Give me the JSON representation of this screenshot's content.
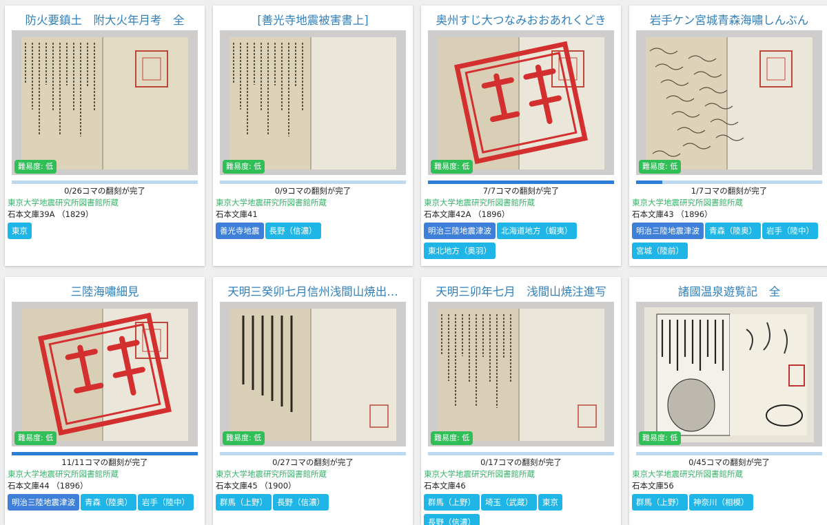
{
  "colors": {
    "title": "#3080bb",
    "badge": "#2fbf56",
    "progress_fill": "#2b7ed6",
    "progress_track": "#bcd9ef",
    "tag": "#1fb5e6",
    "tag_dark": "#3d7fd9",
    "holder": "#3ab36a"
  },
  "cards": [
    {
      "title": "防火要鎮土　附大火年月考　全",
      "badge": "難易度: 低",
      "progress_text": "0/26コマの翻刻が完了",
      "progress": 0.0,
      "holder": "東京大学地震研究所図書館所蔵",
      "call_no": "石本文庫39A （1829）",
      "tags": [
        {
          "label": "東京",
          "dark": false
        }
      ]
    },
    {
      "title": "[善光寺地震被害書上]",
      "badge": "難易度: 低",
      "progress_text": "0/9コマの翻刻が完了",
      "progress": 0.0,
      "holder": "東京大学地震研究所図書館所蔵",
      "call_no": "石本文庫41",
      "tags": [
        {
          "label": "善光寺地震",
          "dark": true
        },
        {
          "label": "長野（信濃）",
          "dark": false
        }
      ]
    },
    {
      "title": "奥州すじ大つなみおおあれくどき",
      "badge": "難易度: 低",
      "progress_text": "7/7コマの翻刻が完了",
      "progress": 1.0,
      "holder": "東京大学地震研究所図書館所蔵",
      "call_no": "石本文庫42A （1896）",
      "tags": [
        {
          "label": "明治三陸地震津波",
          "dark": true
        },
        {
          "label": "北海道地方（蝦夷）",
          "dark": false
        },
        {
          "label": "東北地方（奥羽）",
          "dark": false
        }
      ]
    },
    {
      "title": "岩手ケン宮城青森海嘯しんぶん",
      "badge": "難易度: 低",
      "progress_text": "1/7コマの翻刻が完了",
      "progress": 0.14,
      "holder": "東京大学地震研究所図書館所蔵",
      "call_no": "石本文庫43 （1896）",
      "tags": [
        {
          "label": "明治三陸地震津波",
          "dark": true
        },
        {
          "label": "青森（陸奥）",
          "dark": false
        },
        {
          "label": "岩手（陸中）",
          "dark": false
        },
        {
          "label": "宮城（陸前）",
          "dark": false
        }
      ]
    },
    {
      "title": "三陸海嘯細見",
      "badge": "難易度: 低",
      "progress_text": "11/11コマの翻刻が完了",
      "progress": 1.0,
      "holder": "東京大学地震研究所図書館所蔵",
      "call_no": "石本文庫44 （1896）",
      "tags": [
        {
          "label": "明治三陸地震津波",
          "dark": true
        },
        {
          "label": "青森（陸奥）",
          "dark": false
        },
        {
          "label": "岩手（陸中）",
          "dark": false
        }
      ]
    },
    {
      "title": "天明三癸卯七月信州浅間山焼出…",
      "badge": "難易度: 低",
      "progress_text": "0/27コマの翻刻が完了",
      "progress": 0.0,
      "holder": "東京大学地震研究所図書館所蔵",
      "call_no": "石本文庫45 （1900）",
      "tags": [
        {
          "label": "群馬（上野）",
          "dark": false
        },
        {
          "label": "長野（信濃）",
          "dark": false
        }
      ]
    },
    {
      "title": "天明三卯年七月　浅間山焼注進写",
      "badge": "難易度: 低",
      "progress_text": "0/17コマの翻刻が完了",
      "progress": 0.0,
      "holder": "東京大学地震研究所図書館所蔵",
      "call_no": "石本文庫46",
      "tags": [
        {
          "label": "群馬（上野）",
          "dark": false
        },
        {
          "label": "埼玉（武蔵）",
          "dark": false
        },
        {
          "label": "東京",
          "dark": false
        },
        {
          "label": "長野（信濃）",
          "dark": false
        }
      ]
    },
    {
      "title": "諸國温泉遊覧記　全",
      "badge": "難易度: 低",
      "progress_text": "0/45コマの翻刻が完了",
      "progress": 0.0,
      "holder": "東京大学地震研究所図書館所蔵",
      "call_no": "石本文庫56",
      "tags": [
        {
          "label": "群馬（上野）",
          "dark": false
        },
        {
          "label": "神奈川（相模）",
          "dark": false
        }
      ]
    }
  ],
  "thumbs": [
    "text-pages-stamp",
    "text-pages",
    "stamp-honkoku-cover",
    "illustration-pages",
    "stamp-honkoku-cover",
    "inscribed-pages",
    "script-pages",
    "illustrated-woodblock"
  ]
}
